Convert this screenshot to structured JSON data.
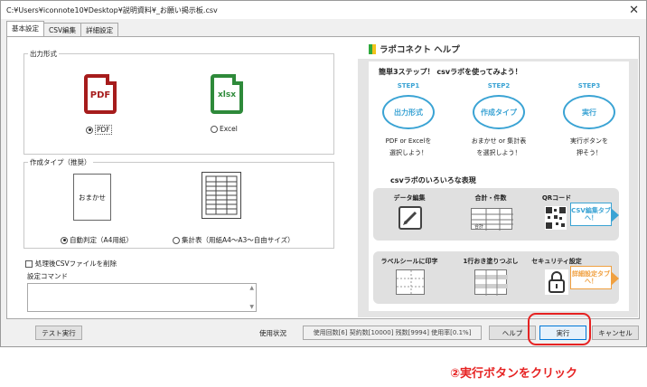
{
  "window": {
    "title": "C:¥Users¥iconnote10¥Desktop¥説明資料¥_お願い掲示板.csv",
    "close_glyph": "✕"
  },
  "tabs": [
    {
      "label": "基本設定",
      "active": true
    },
    {
      "label": "CSV編集",
      "active": false
    },
    {
      "label": "詳細設定",
      "active": false
    }
  ],
  "output_format": {
    "title": "出力形式",
    "pdf_icon_text": "PDF",
    "xlsx_icon_text": "xlsx",
    "options": [
      {
        "label": "PDF",
        "selected": true
      },
      {
        "label": "Excel",
        "selected": false
      }
    ]
  },
  "creation_type": {
    "title": "作成タイプ（推奨）",
    "omakase_text": "おまかせ",
    "options": [
      {
        "label": "自動判定（A4用紙）",
        "selected": true
      },
      {
        "label": "集計表（用紙A4～A3～自由サイズ）",
        "selected": false
      }
    ]
  },
  "delete_checkbox_label": "処理後CSVファイルを削除",
  "command": {
    "title": "設定コマンド",
    "value": ""
  },
  "help": {
    "title": "ラポコネクト ヘルプ",
    "leaf_colors": [
      "#2eaa3c",
      "#f2c21b"
    ],
    "subtitle1": "簡単3ステップ！ csvラボを使ってみよう！",
    "steps": [
      {
        "label": "STEP1",
        "circle": "出力形式",
        "desc1": "PDF or Excelを",
        "desc2": "選択しよう！"
      },
      {
        "label": "STEP2",
        "circle": "作成タイプ",
        "desc1": "おまかせ or 集計表",
        "desc2": "を選択しよう！"
      },
      {
        "label": "STEP3",
        "circle": "実行",
        "desc1": "実行ボタンを",
        "desc2": "押そう！"
      }
    ],
    "subtitle2": "csvラボのいろいろな表現",
    "features_row1": [
      "データ編集",
      "合計・件数",
      "QRコード"
    ],
    "features_row2": [
      "ラベルシールに印字",
      "1行おき塗りつぶし",
      "セキュリティ設定"
    ],
    "sum_label": "合計",
    "callout_csv": "CSV編集タブへ！",
    "callout_detail": "詳細設定タブへ！"
  },
  "bottom": {
    "test_button": "テスト実行",
    "usage_label": "使用状況",
    "usage_status": "使用回数[6] 契約数[10000] 残数[9994] 使用率[0.1%]",
    "help_button": "ヘルプ",
    "run_button": "実行",
    "cancel_button": "キャンセル"
  },
  "instruction": "②実行ボタンをクリック",
  "colors": {
    "accent_blue": "#3aa3d4",
    "pdf_red": "#a61c1c",
    "excel_green": "#2e8a3a",
    "highlight_red": "#e62222",
    "callout_orange": "#f0a040"
  }
}
